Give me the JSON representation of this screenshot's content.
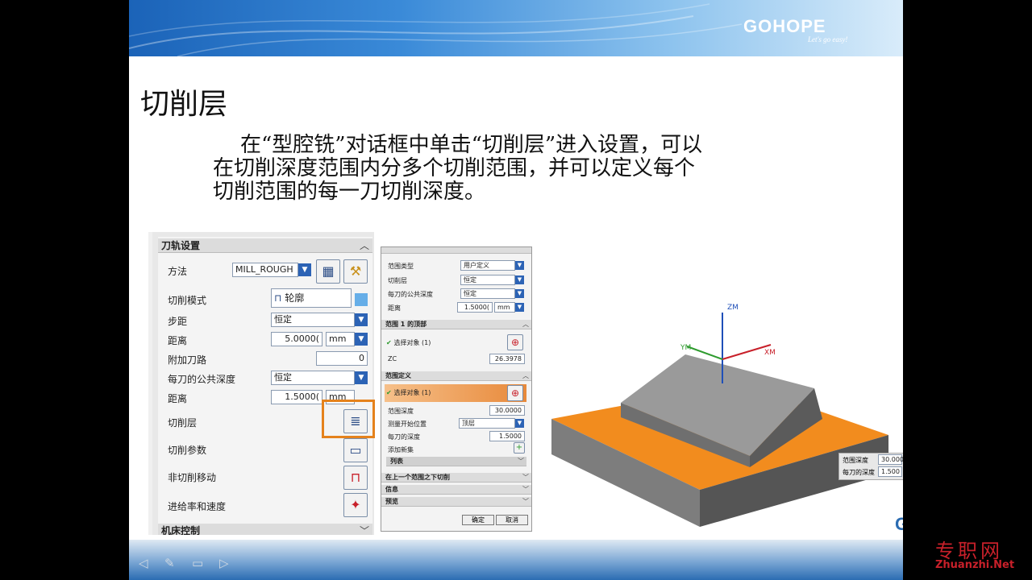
{
  "brand": {
    "name": "GOHOPE",
    "tagline": "Let's go easy!",
    "watermark_brand": "GOHOPE",
    "watermark_cn": "专职网",
    "watermark_url": "Zhuanzhi.Net"
  },
  "slide": {
    "title": "切削层",
    "body_line1": "在“型腔铣”对话框中单击“切削层”进入设置，可以",
    "body_line2": "在切削深度范围内分多个切削范围，并可以定义每个",
    "body_line3": "切削范围的每一刀切削深度。"
  },
  "panel1": {
    "section_title": "刀轨设置",
    "bottom_section": "机床控制",
    "method_label": "方法",
    "method_value": "MILL_ROUGH",
    "cut_pattern_label": "切削模式",
    "cut_pattern_value": "轮廓",
    "stepover_label": "步距",
    "stepover_value": "恒定",
    "distance_label": "距离",
    "distance_value": "5.0000(",
    "unit_mm": "mm",
    "extra_passes_label": "附加刀路",
    "extra_passes_value": "0",
    "common_depth_label": "每刀的公共深度",
    "common_depth_value": "恒定",
    "distance2_label": "距离",
    "distance2_value": "1.5000(",
    "unit_mm2": "mm",
    "cut_levels_label": "切削层",
    "cut_params_label": "切削参数",
    "non_cut_label": "非切削移动",
    "feeds_label": "进给率和速度"
  },
  "panel2": {
    "range_type_label": "范围类型",
    "range_type_value": "用户定义",
    "cut_levels_label": "切削层",
    "cut_levels_value": "恒定",
    "common_depth_label": "每刀的公共深度",
    "common_depth_value": "恒定",
    "distance_label": "距离",
    "distance_value": "1.5000(",
    "unit": "mm",
    "range1_top_head": "范围 1 的顶部",
    "select_object_1": "选择对象 (1)",
    "zc_label": "ZC",
    "zc_value": "26.3978",
    "range_def_head": "范围定义",
    "select_object_2": "选择对象 (1)",
    "range_depth_label": "范围深度",
    "range_depth_value": "30.0000",
    "measure_from_label": "测量开始位置",
    "measure_from_value": "顶层",
    "depth_per_cut_label": "每刀的深度",
    "depth_per_cut_value": "1.5000",
    "add_new_set_label": "添加新集",
    "list_head": "列表",
    "below_range_head": "在上一个范围之下切削",
    "info_head": "信息",
    "preview_head": "预览",
    "ok_label": "确定",
    "cancel_label": "取消"
  },
  "model": {
    "zm": "ZM",
    "xm": "XM",
    "ym": "YM",
    "popup_range_depth_label": "范围深度",
    "popup_range_depth_value": "30.000",
    "popup_depth_per_cut_label": "每刀的深度",
    "popup_depth_per_cut_value": "1.500"
  },
  "colors": {
    "accent_orange": "#e5821c",
    "slide_bg": "#ffffff",
    "banner_blue": "#1b63b8",
    "part_top": "#f28c1e"
  }
}
